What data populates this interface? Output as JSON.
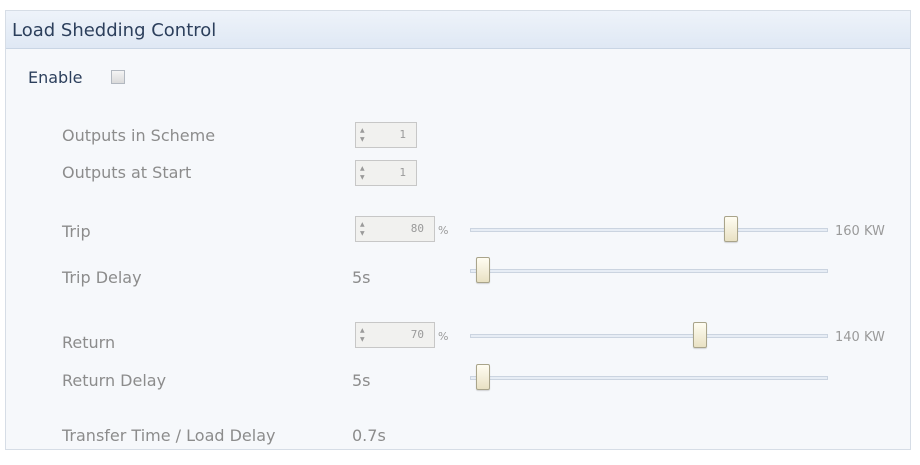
{
  "header": {
    "title": "Load Shedding Control"
  },
  "enable": {
    "label": "Enable",
    "checked": false
  },
  "fields": {
    "outputs_in_scheme": {
      "label": "Outputs in Scheme",
      "value": "1"
    },
    "outputs_at_start": {
      "label": "Outputs at Start",
      "value": "1"
    },
    "trip": {
      "label": "Trip",
      "value": "80",
      "unit": "%",
      "kw": "160 KW",
      "slider_fraction": 0.72
    },
    "trip_delay": {
      "label": "Trip Delay",
      "value": "5s",
      "slider_fraction": 0.0
    },
    "return": {
      "label": "Return",
      "value": "70",
      "unit": "%",
      "kw": "140 KW",
      "slider_fraction": 0.63
    },
    "return_delay": {
      "label": "Return Delay",
      "value": "5s",
      "slider_fraction": 0.0
    },
    "transfer_time": {
      "label": "Transfer Time / Load Delay",
      "value": "0.7s"
    }
  },
  "icons": {
    "spinner_up": "▲",
    "spinner_down": "▼"
  },
  "colors": {
    "header_text": "#2c3f5c",
    "label_text": "#8c8c8c",
    "thumb": "#f4efd8"
  }
}
